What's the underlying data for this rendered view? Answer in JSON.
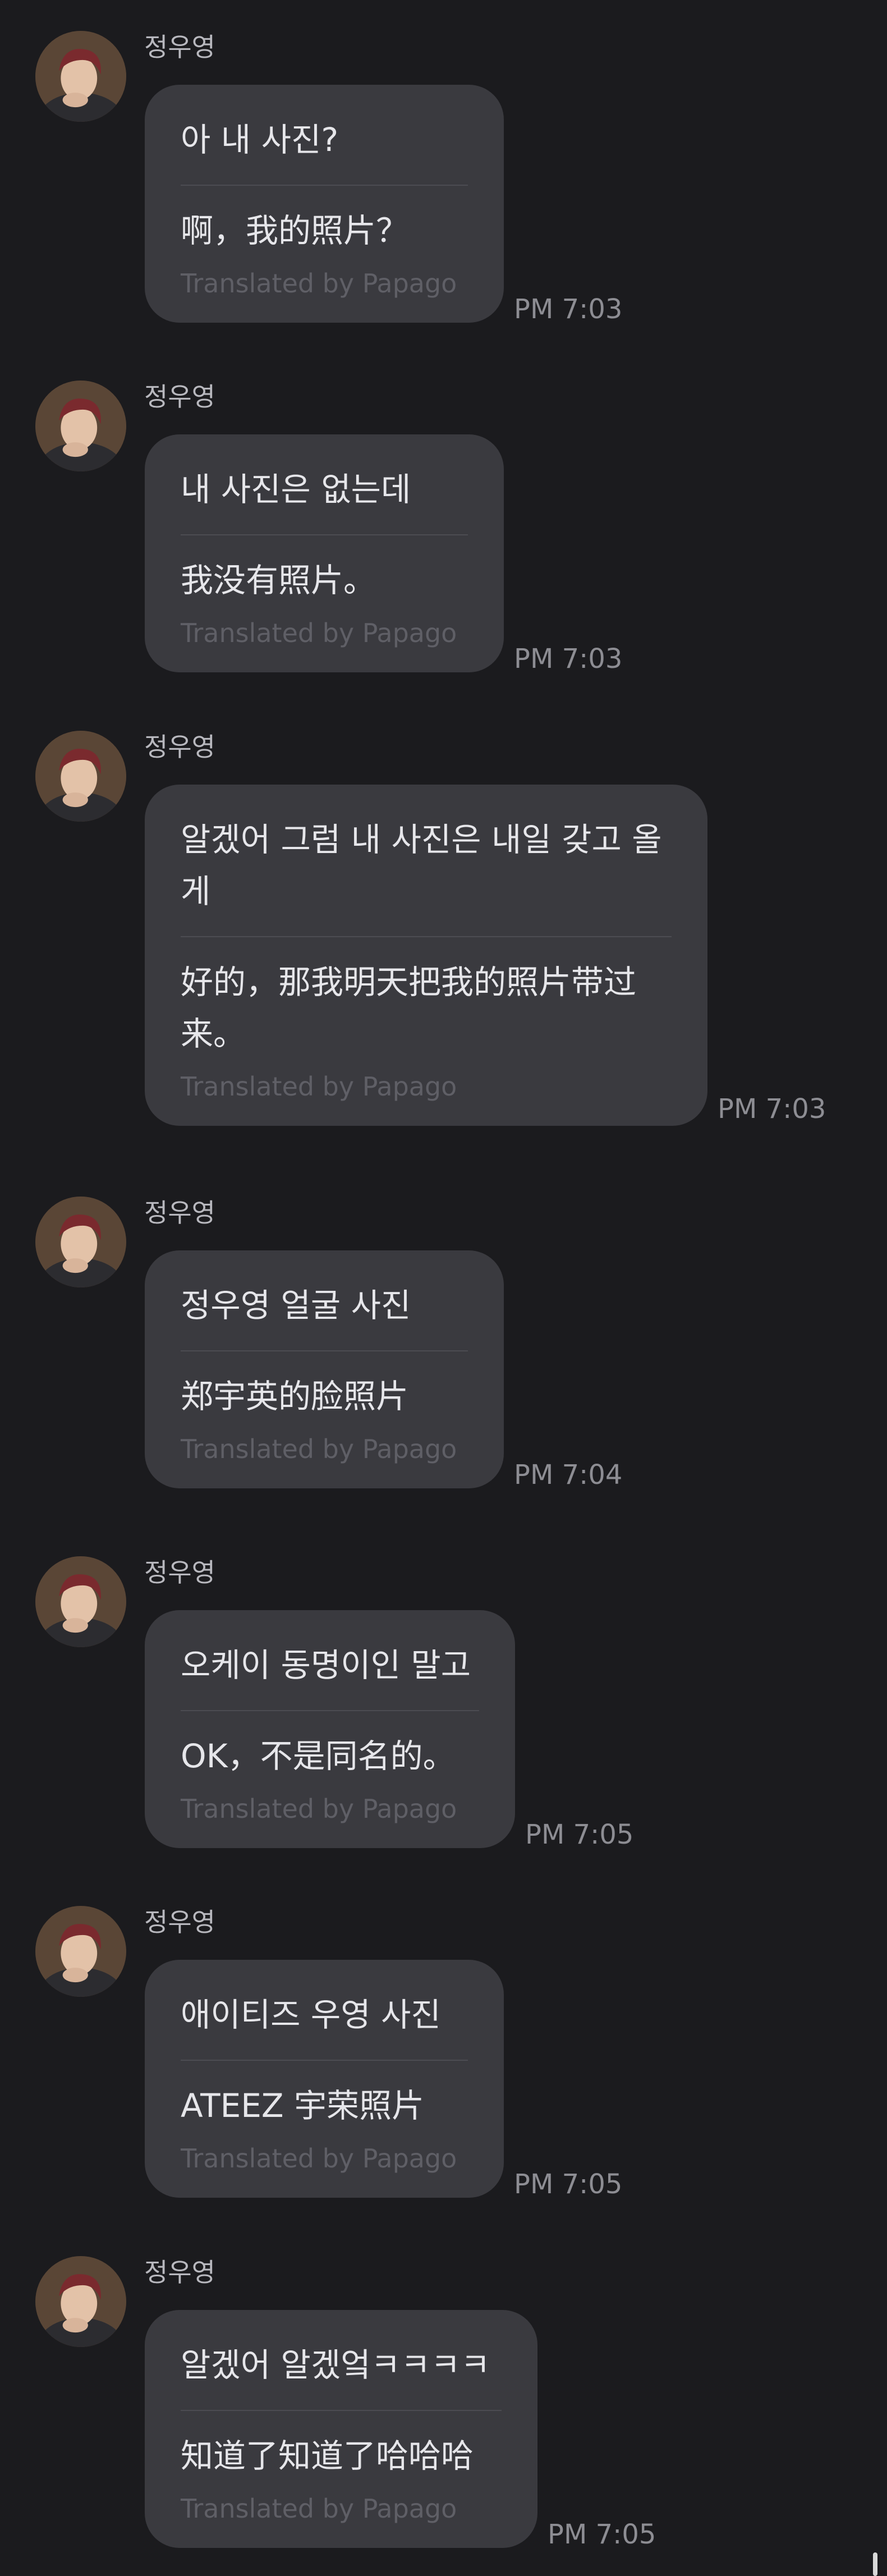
{
  "messages": [
    {
      "sender": "정우영",
      "original": "아 내 사진?",
      "translation": "啊，我的照片？",
      "credit": "Translated by Papago",
      "time": "PM 7:03",
      "avatar_icon": "user-avatar-photo"
    },
    {
      "sender": "정우영",
      "original": "내 사진은 없는데",
      "translation": "我没有照片。",
      "credit": "Translated by Papago",
      "time": "PM 7:03",
      "avatar_icon": "user-avatar-photo"
    },
    {
      "sender": "정우영",
      "original": "알겠어 그럼 내 사진은 내일 갖고 올게",
      "translation": "好的，那我明天把我的照片带过来。",
      "credit": "Translated by Papago",
      "time": "PM 7:03",
      "avatar_icon": "user-avatar-photo"
    },
    {
      "sender": "정우영",
      "original": "정우영 얼굴 사진",
      "translation": "郑宇英的脸照片",
      "credit": "Translated by Papago",
      "time": "PM 7:04",
      "avatar_icon": "user-avatar-photo"
    },
    {
      "sender": "정우영",
      "original": "오케이 동명이인 말고",
      "translation": "OK，不是同名的。",
      "credit": "Translated by Papago",
      "time": "PM 7:05",
      "avatar_icon": "user-avatar-photo"
    },
    {
      "sender": "정우영",
      "original": "애이티즈 우영 사진",
      "translation": "ATEEZ 宇荣照片",
      "credit": "Translated by Papago",
      "time": "PM 7:05",
      "avatar_icon": "user-avatar-photo"
    },
    {
      "sender": "정우영",
      "original": "알겠어 알겠엌ㅋㅋㅋㅋ",
      "translation": "知道了知道了哈哈哈",
      "credit": "Translated by Papago",
      "time": "PM 7:05",
      "avatar_icon": "user-avatar-photo"
    }
  ],
  "colors": {
    "background": "#1b1b1e",
    "bubble": "#3a3a3f",
    "text": "#e6e6ea",
    "muted": "#8d8d93"
  }
}
